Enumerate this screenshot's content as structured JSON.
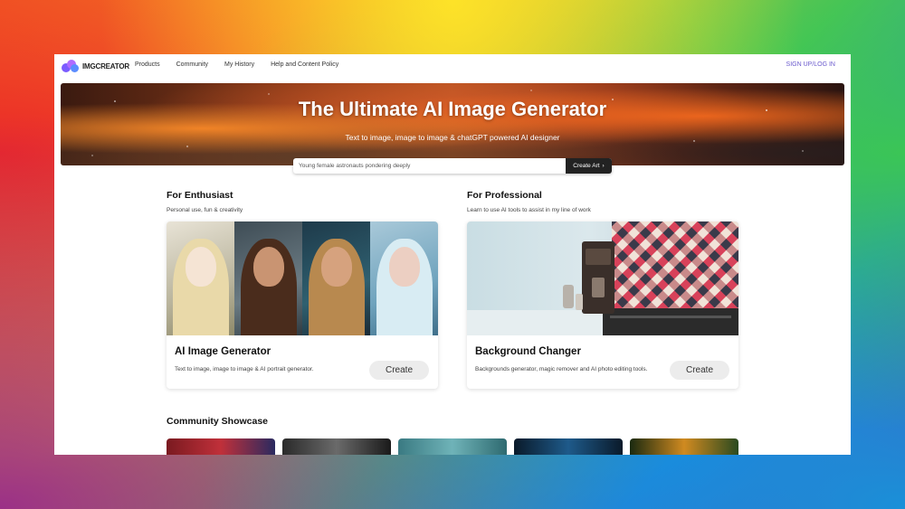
{
  "nav": {
    "logo_text": "IMGCREATOR",
    "links": [
      "Products",
      "Community",
      "My History",
      "Help and Content Policy"
    ],
    "signup": "SIGN UP/LOG IN"
  },
  "hero": {
    "title": "The Ultimate AI Image Generator",
    "subtitle": "Text to image, image to image & chatGPT powered AI designer",
    "search_value": "Young female astronauts pondering deeply",
    "button_label": "Create Art"
  },
  "enthusiast": {
    "heading": "For Enthusiast",
    "subheading": "Personal use, fun & creativity",
    "card_title": "AI Image Generator",
    "card_desc": "Text to image, image to image & AI portrait generator.",
    "button": "Create"
  },
  "professional": {
    "heading": "For Professional",
    "subheading": "Learn to use AI tools to assist in my line of work",
    "card_title": "Background Changer",
    "card_desc": "Backgrounds generator, magic remover and AI photo editing tools.",
    "button": "Create"
  },
  "showcase": {
    "heading": "Community Showcase"
  },
  "colors": {
    "accent": "#6a5acd",
    "dark_button": "#222222"
  }
}
